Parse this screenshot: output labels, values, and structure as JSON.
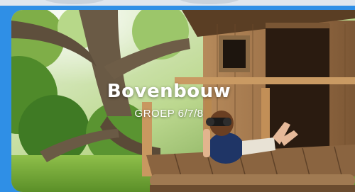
{
  "card": {
    "title": "Bovenbouw",
    "subtitle": "GROEP 6/7/8"
  },
  "colors": {
    "frame_blue": "#2f8fe6",
    "text": "#ffffff"
  },
  "image": {
    "subject": "treehouse-photo"
  }
}
